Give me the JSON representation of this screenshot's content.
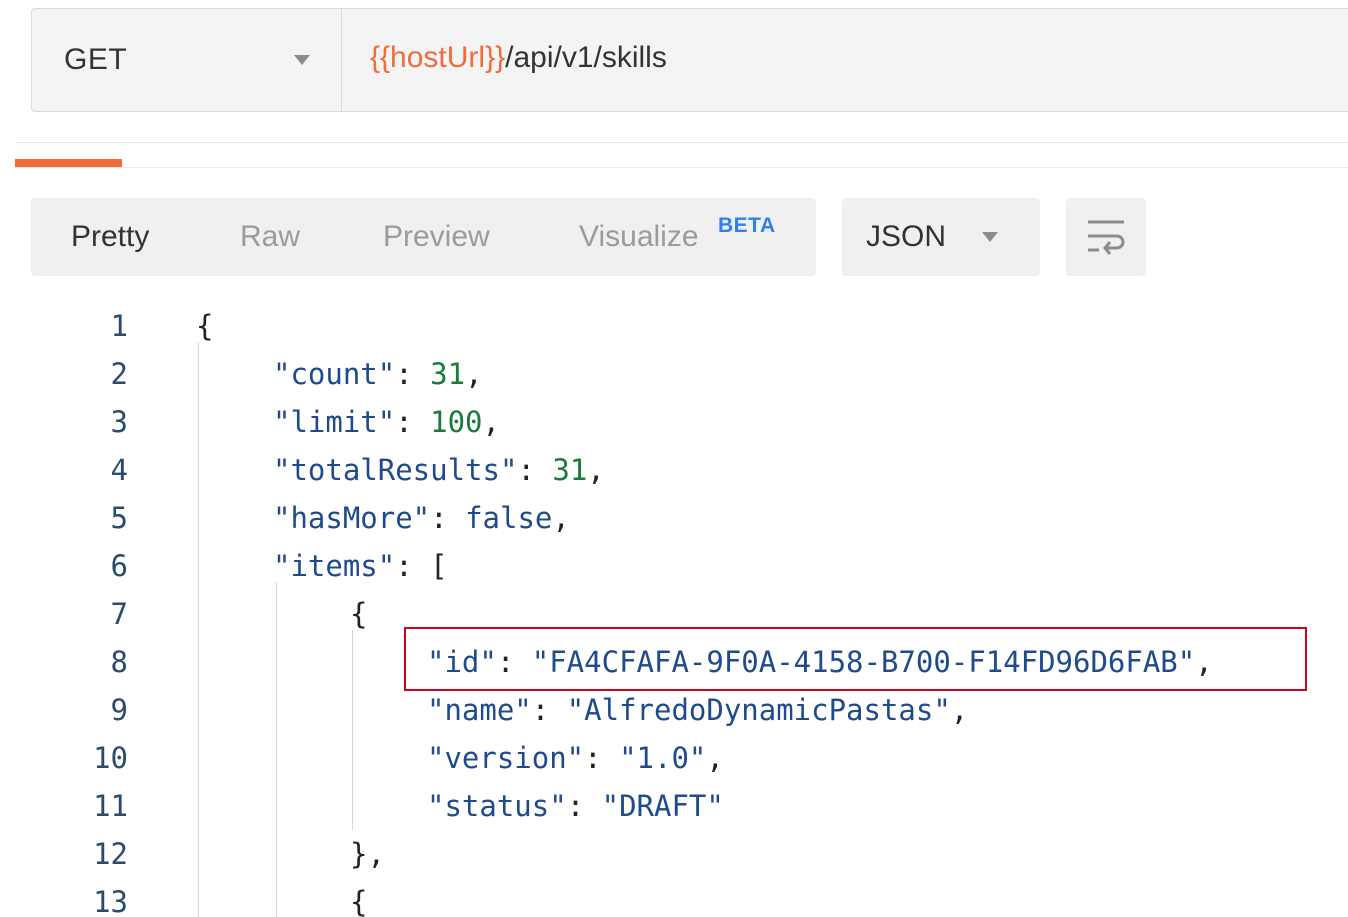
{
  "request": {
    "method": "GET",
    "url_variable": "{{hostUrl}}",
    "url_path": "/api/v1/skills"
  },
  "response_toolbar": {
    "view_modes": [
      {
        "label": "Pretty",
        "active": true
      },
      {
        "label": "Raw",
        "active": false
      },
      {
        "label": "Preview",
        "active": false
      },
      {
        "label": "Visualize",
        "active": false
      }
    ],
    "beta_badge": "BETA",
    "format": "JSON",
    "wrap_icon": "wrap-lines-icon"
  },
  "code": {
    "line_numbers": [
      "1",
      "2",
      "3",
      "4",
      "5",
      "6",
      "7",
      "8",
      "9",
      "10",
      "11",
      "12",
      "13"
    ],
    "lines": [
      "{",
      "\"count\": 31,",
      "\"limit\": 100,",
      "\"totalResults\": 31,",
      "\"hasMore\": false,",
      "\"items\": [",
      "{",
      "\"id\": \"FA4CFAFA-9F0A-4158-B700-F14FD96D6FAB\",",
      "\"name\": \"AlfredoDynamicPastas\",",
      "\"version\": \"1.0\",",
      "\"status\": \"DRAFT\"",
      "},",
      "{"
    ],
    "highlighted_line": "8"
  },
  "colors": {
    "accent": "#f26b3a",
    "highlight_border": "#d0021b",
    "beta": "#2f80ed",
    "number": "#1a7a3a",
    "key": "#1f4a8c"
  }
}
